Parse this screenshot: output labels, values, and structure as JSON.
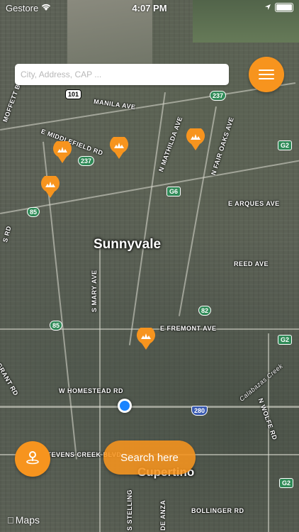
{
  "status_bar": {
    "carrier": "Gestore",
    "time": "4:07 PM"
  },
  "search": {
    "placeholder": "City, Address, CAP ..."
  },
  "map": {
    "city_labels": [
      "Sunnyvale",
      "Cupertino"
    ],
    "road_labels": [
      "MOFFETT BLVD",
      "MANILA AVE",
      "E MIDDLEFIELD RD",
      "N MATHILDA AVE",
      "N FAIR OAKS AVE",
      "E ARQUES AVE",
      "REED AVE",
      "S MARY AVE",
      "E FREMONT AVE",
      "GRANT RD",
      "W HOMESTEAD RD",
      "N WOLFE RD",
      "STEVENS CREEK BLVD",
      "S STELLING",
      "DE ANZA",
      "BOLLINGER RD",
      "Calabazas Creek",
      "S RD"
    ],
    "shields": [
      "101",
      "237",
      "237",
      "G6",
      "85",
      "85",
      "82",
      "280",
      "G2",
      "G2",
      "G2"
    ]
  },
  "buttons": {
    "search_here": "Search here"
  },
  "attribution": {
    "text": "Maps"
  },
  "colors": {
    "accent": "#f7941e",
    "user_location": "#1a84ff"
  }
}
